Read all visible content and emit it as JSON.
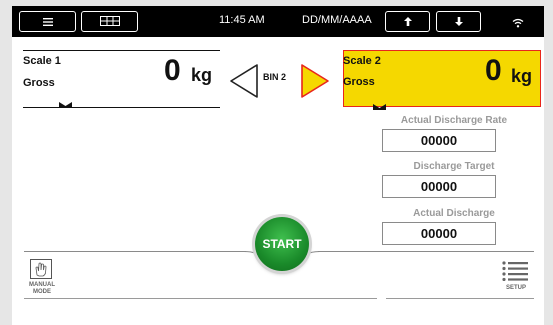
{
  "topbar": {
    "menu_icon": "hamburger-icon",
    "grid_icon": "grid-icon",
    "time": "11:45 AM",
    "date": "DD/MM/AAAA",
    "up_icon": "arrow-up-icon",
    "down_icon": "arrow-down-icon",
    "wifi_icon": "wifi-icon"
  },
  "scale1": {
    "title": "Scale 1",
    "mode": "Gross",
    "value": "0",
    "unit": "kg"
  },
  "bin": {
    "label": "BIN 2",
    "left_arrow_icon": "triangle-left-icon",
    "right_arrow_icon": "triangle-right-icon",
    "active_color": "#f5d800"
  },
  "scale2": {
    "title": "Scale 2",
    "mode": "Gross",
    "value": "0",
    "unit": "kg",
    "highlight_color": "#f5d800",
    "border_color": "#e8261c"
  },
  "fields": {
    "rate_label": "Actual Discharge Rate",
    "rate_value": "00000",
    "target_label": "Discharge Target",
    "target_value": "00000",
    "discharge_label": "Actual Discharge",
    "discharge_value": "00000"
  },
  "start_button": {
    "label": "START",
    "color": "#1a8a2a"
  },
  "manual_mode": {
    "icon": "hand-icon",
    "label_line1": "MANUAL",
    "label_line2": "MODE"
  },
  "setup": {
    "icon": "list-menu-icon",
    "label": "SETUP"
  }
}
